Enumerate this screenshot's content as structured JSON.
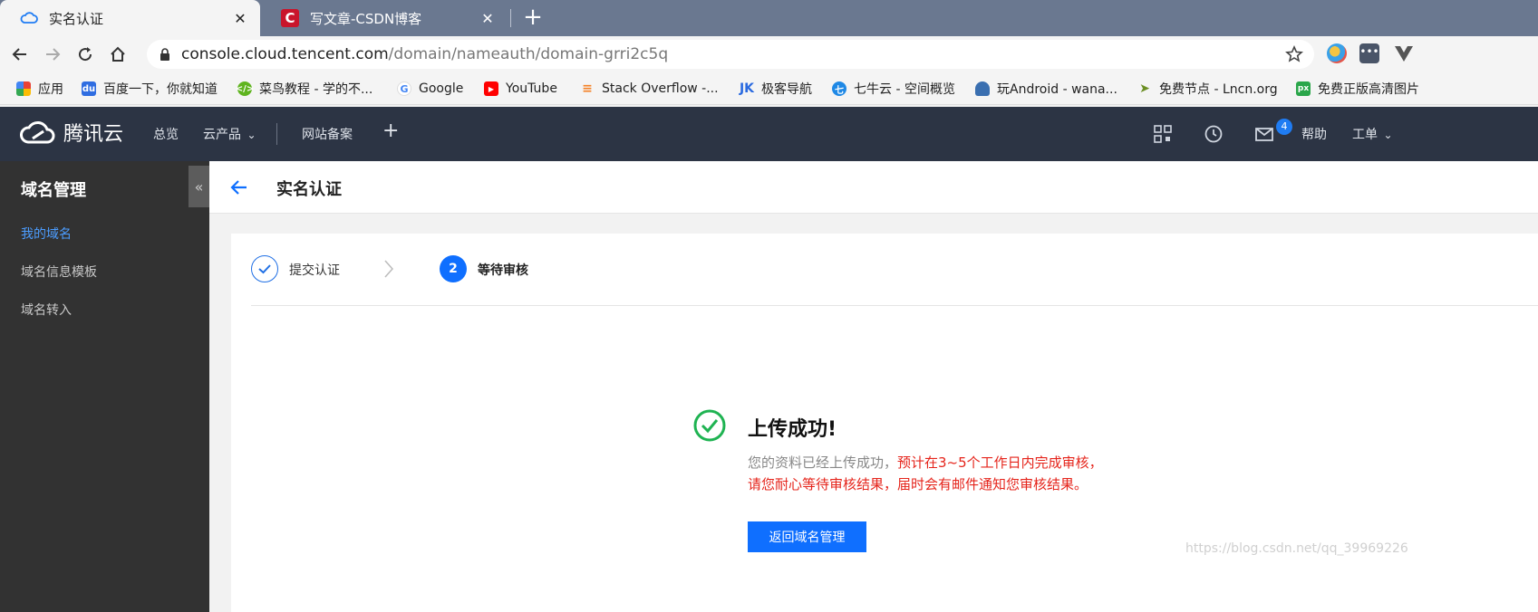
{
  "browser": {
    "tabs": [
      {
        "title": "实名认证",
        "icon": "tencent-cloud-icon",
        "active": true
      },
      {
        "title": "写文章-CSDN博客",
        "icon": "csdn-icon",
        "active": false
      }
    ],
    "close_glyph": "✕",
    "new_tab_glyph": "+",
    "url_host": "console.cloud.tencent.com",
    "url_path": "/domain/nameauth/domain-grri2c5q",
    "bookmarks": [
      {
        "label": "应用",
        "icon": "apps-grid-icon"
      },
      {
        "label": "百度一下，你就知道",
        "icon": "baidu-icon"
      },
      {
        "label": "菜鸟教程 - 学的不...",
        "icon": "runoob-icon"
      },
      {
        "label": "Google",
        "icon": "google-icon"
      },
      {
        "label": "YouTube",
        "icon": "youtube-icon"
      },
      {
        "label": "Stack Overflow -...",
        "icon": "stackoverflow-icon"
      },
      {
        "label": "极客导航",
        "icon": "jike-icon"
      },
      {
        "label": "七牛云 - 空间概览",
        "icon": "qiniu-icon"
      },
      {
        "label": "玩Android - wana...",
        "icon": "android-icon"
      },
      {
        "label": "免费节点 - Lncn.org",
        "icon": "paper-plane-icon"
      },
      {
        "label": "免费正版高清图片",
        "icon": "pexels-icon"
      }
    ]
  },
  "header": {
    "logo_text": "腾讯云",
    "nav": [
      "总览",
      "云产品",
      "网站备案"
    ],
    "dropdown_glyph": "⌄",
    "add_glyph": "+",
    "mail_badge": "4",
    "help_label": "帮助",
    "ticket_label": "工单"
  },
  "sidebar": {
    "title": "域名管理",
    "items": [
      {
        "label": "我的域名",
        "active": true
      },
      {
        "label": "域名信息模板",
        "active": false
      },
      {
        "label": "域名转入",
        "active": false
      }
    ],
    "collapse_glyph": "«"
  },
  "page": {
    "title": "实名认证"
  },
  "steps": [
    {
      "label": "提交认证",
      "state": "done"
    },
    {
      "number": "2",
      "label": "等待审核",
      "state": "current"
    }
  ],
  "result": {
    "title": "上传成功!",
    "line1_gray": "您的资料已经上传成功，",
    "line1_red": "预计在3~5个工作日内完成审核，",
    "line2_red": "请您耐心等待审核结果，届时会有邮件通知您审核结果。",
    "button_label": "返回域名管理"
  },
  "watermark": "https://blog.csdn.net/qq_39969226",
  "colors": {
    "primary": "#0f6fff",
    "success": "#1fb352",
    "warning_text": "#e5241b",
    "header_bg": "#2c3444",
    "sidebar_bg": "#323232"
  }
}
